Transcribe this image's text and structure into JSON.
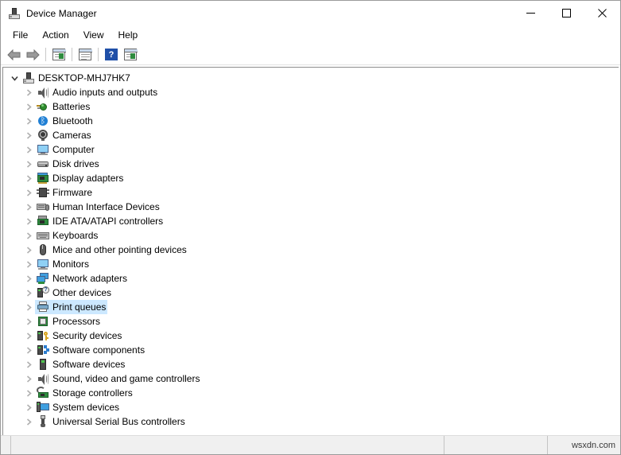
{
  "window": {
    "title": "Device Manager",
    "icon": "computer-icon",
    "controls": {
      "minimize": "minimize-icon",
      "maximize": "maximize-icon",
      "close": "close-icon"
    }
  },
  "menubar": {
    "items": [
      {
        "label": "File"
      },
      {
        "label": "Action"
      },
      {
        "label": "View"
      },
      {
        "label": "Help"
      }
    ]
  },
  "toolbar": {
    "buttons": [
      {
        "name": "back-button",
        "icon": "arrow-left-icon"
      },
      {
        "name": "forward-button",
        "icon": "arrow-right-icon"
      },
      {
        "name": "separator-1",
        "icon": "separator"
      },
      {
        "name": "properties-button",
        "icon": "window-properties-icon"
      },
      {
        "name": "separator-2",
        "icon": "separator"
      },
      {
        "name": "update-driver-button",
        "icon": "window-list-icon"
      },
      {
        "name": "separator-3",
        "icon": "separator"
      },
      {
        "name": "help-button",
        "icon": "question-mark-icon"
      },
      {
        "name": "scan-hardware-button",
        "icon": "window-scan-icon"
      }
    ]
  },
  "tree": {
    "root": {
      "label": "DESKTOP-MHJ7HK7",
      "icon": "computer-icon",
      "expanded": true,
      "chevron": "chevron-down-icon"
    },
    "items": [
      {
        "label": "Audio inputs and outputs",
        "icon": "speaker-icon",
        "selected": false
      },
      {
        "label": "Batteries",
        "icon": "battery-icon",
        "selected": false
      },
      {
        "label": "Bluetooth",
        "icon": "bluetooth-icon",
        "selected": false
      },
      {
        "label": "Cameras",
        "icon": "camera-icon",
        "selected": false
      },
      {
        "label": "Computer",
        "icon": "monitor-icon",
        "selected": false
      },
      {
        "label": "Disk drives",
        "icon": "disk-drive-icon",
        "selected": false
      },
      {
        "label": "Display adapters",
        "icon": "display-adapter-icon",
        "selected": false
      },
      {
        "label": "Firmware",
        "icon": "chip-icon",
        "selected": false
      },
      {
        "label": "Human Interface Devices",
        "icon": "keyboard-mouse-icon",
        "selected": false
      },
      {
        "label": "IDE ATA/ATAPI controllers",
        "icon": "ide-controller-icon",
        "selected": false
      },
      {
        "label": "Keyboards",
        "icon": "keyboard-icon",
        "selected": false
      },
      {
        "label": "Mice and other pointing devices",
        "icon": "mouse-icon",
        "selected": false
      },
      {
        "label": "Monitors",
        "icon": "monitor-icon",
        "selected": false
      },
      {
        "label": "Network adapters",
        "icon": "network-adapter-icon",
        "selected": false
      },
      {
        "label": "Other devices",
        "icon": "unknown-device-icon",
        "selected": false
      },
      {
        "label": "Print queues",
        "icon": "printer-icon",
        "selected": true
      },
      {
        "label": "Processors",
        "icon": "processor-icon",
        "selected": false
      },
      {
        "label": "Security devices",
        "icon": "security-device-icon",
        "selected": false
      },
      {
        "label": "Software components",
        "icon": "software-component-icon",
        "selected": false
      },
      {
        "label": "Software devices",
        "icon": "software-device-icon",
        "selected": false
      },
      {
        "label": "Sound, video and game controllers",
        "icon": "speaker-icon",
        "selected": false
      },
      {
        "label": "Storage controllers",
        "icon": "storage-controller-icon",
        "selected": false
      },
      {
        "label": "System devices",
        "icon": "system-device-icon",
        "selected": false
      },
      {
        "label": "Universal Serial Bus controllers",
        "icon": "usb-icon",
        "selected": false
      }
    ],
    "child_chevron": "chevron-right-icon"
  },
  "statusbar": {
    "pane_main": "",
    "pane_secondary": "",
    "watermark": "wsxdn.com"
  },
  "colors": {
    "selection": "#cce8ff",
    "window_bg": "#ffffff",
    "statusbar_bg": "#f0f0f0",
    "border": "#8d8d8d",
    "accent_blue": "#1f7fd4",
    "accent_green": "#2e8b3e"
  }
}
